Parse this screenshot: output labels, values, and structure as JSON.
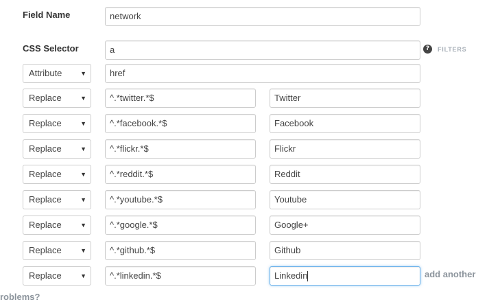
{
  "field_name": {
    "label": "Field Name",
    "value": "network"
  },
  "css_selector": {
    "label": "CSS Selector",
    "value": "a",
    "help_icon": "question-circle-icon",
    "filters_link": "FILTERS"
  },
  "attribute_row": {
    "select": "Attribute",
    "value": "href"
  },
  "replace_rows": [
    {
      "action": "Replace",
      "pattern": "^.*twitter.*$",
      "replacement": "Twitter"
    },
    {
      "action": "Replace",
      "pattern": "^.*facebook.*$",
      "replacement": "Facebook"
    },
    {
      "action": "Replace",
      "pattern": "^.*flickr.*$",
      "replacement": "Flickr"
    },
    {
      "action": "Replace",
      "pattern": "^.*reddit.*$",
      "replacement": "Reddit"
    },
    {
      "action": "Replace",
      "pattern": "^.*youtube.*$",
      "replacement": "Youtube"
    },
    {
      "action": "Replace",
      "pattern": "^.*google.*$",
      "replacement": "Google+"
    },
    {
      "action": "Replace",
      "pattern": "^.*github.*$",
      "replacement": "Github"
    },
    {
      "action": "Replace",
      "pattern": "^.*linkedin.*$",
      "replacement": "Linkedin"
    }
  ],
  "add_another": "add another",
  "problems_link": "problems?",
  "dropdown_arrow": "▼"
}
